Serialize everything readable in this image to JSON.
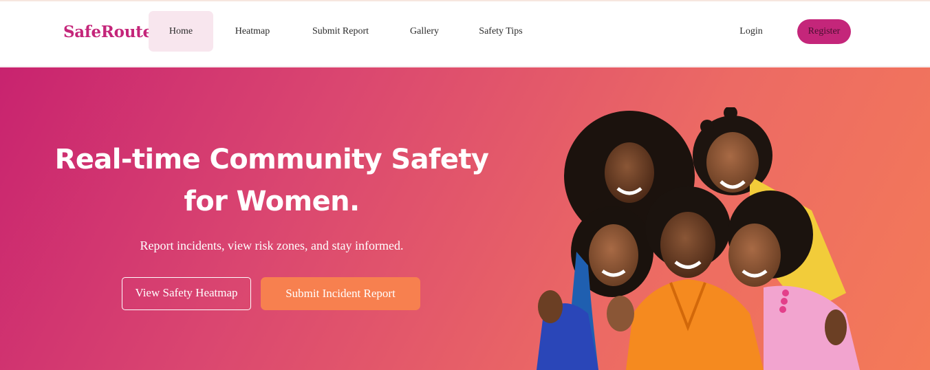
{
  "nav": {
    "brand": "SafeRoute",
    "items": [
      {
        "label": "Home",
        "active": true
      },
      {
        "label": "Heatmap",
        "active": false
      },
      {
        "label": "Submit Report",
        "active": false
      },
      {
        "label": "Gallery",
        "active": false
      },
      {
        "label": "Safety Tips",
        "active": false
      }
    ],
    "login": "Login",
    "register": "Register"
  },
  "hero": {
    "title_line1": "Real-time Community Safety",
    "title_line2": "for Women.",
    "subtitle": "Report incidents, view risk zones, and stay informed.",
    "primary_button": "View Safety Heatmap",
    "secondary_button": "Submit Incident Report"
  },
  "colors": {
    "brand": "#c4267a",
    "active_nav_bg": "#f8e6ee",
    "hero_gradient_start": "#c8236f",
    "hero_gradient_end": "#f47a58",
    "cta_orange": "#f7804f"
  }
}
